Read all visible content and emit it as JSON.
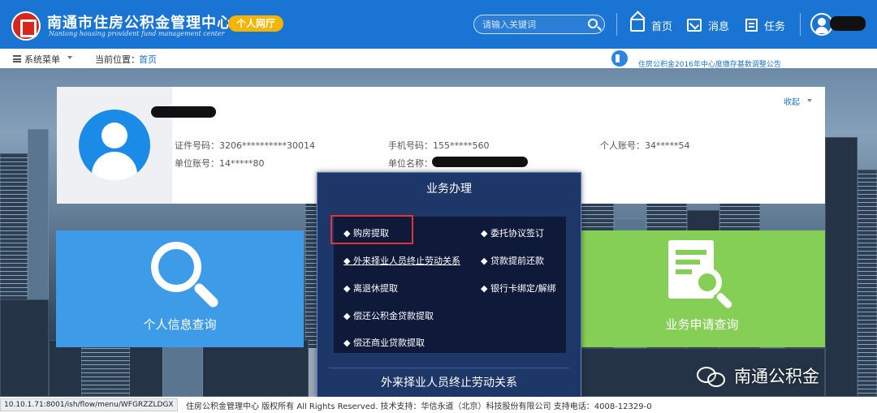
{
  "header": {
    "title": "南通市住房公积金管理中心",
    "subtitle": "Nantong housing provident fund management center",
    "badge": "个人网厅",
    "search_placeholder": "请输入关键词",
    "nav": [
      {
        "label": "首页",
        "icon": "home-icon"
      },
      {
        "label": "消息",
        "icon": "message-icon"
      },
      {
        "label": "任务",
        "icon": "task-icon"
      }
    ]
  },
  "breadcrumb": {
    "menu_label": "系统菜单",
    "position_label": "当前位置：",
    "position_link": "首页",
    "notice": "住房公积金2016年中心度缴存基数调整公告"
  },
  "profile": {
    "collapse_label": "收起",
    "fields": {
      "id_number": "证件号码：3206**********30014",
      "phone": "手机号码：155*****560",
      "account": "个人账号：34*****54",
      "unit_account": "单位账号：14*****80",
      "unit_name": "单位名称："
    }
  },
  "tiles": {
    "personal_query": "个人信息查询",
    "application_query": "业务申请查询"
  },
  "business": {
    "title": "业务办理",
    "items": [
      "◆ 购房提取",
      "◆ 委托协议签订",
      "◆ 外来择业人员终止劳动关系",
      "◆ 贷款提前还款",
      "◆ 离退休提取",
      "◆ 银行卡绑定/解绑",
      "◆ 偿还公积金贷款提取",
      "◆ 偿还商业贷款提取"
    ],
    "bottom_title": "外来择业人员终止劳动关系"
  },
  "watermark": "南通公积金",
  "footer": {
    "url": "10.10.1.71:8001/ish/flow/menu/WFGRZZLDGX",
    "copyright": "住房公积金管理中心 版权所有 All Rights Reserved. 技术支持：华信永道（北京）科技股份有限公司 支持电话：4008-12329-0"
  },
  "colors": {
    "header_blue": "#1a74d3",
    "badge_yellow": "#f5b400",
    "tile_blue": "#3d9be8",
    "tile_green": "#86cf57",
    "panel_navy": "#1d3768",
    "highlight_red": "#e53333"
  }
}
